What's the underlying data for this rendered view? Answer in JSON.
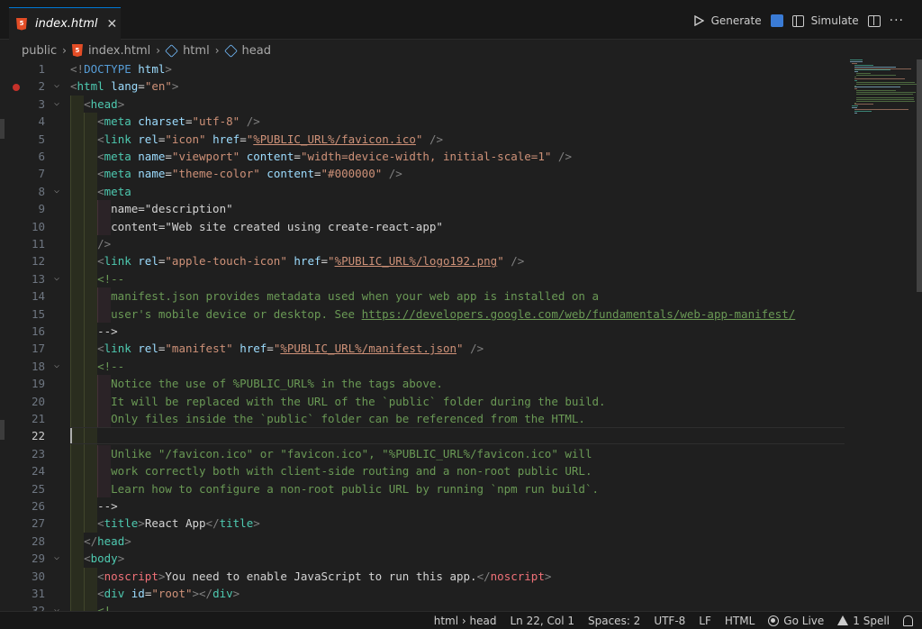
{
  "tab": {
    "title": "index.html",
    "close_glyph": "✕",
    "file_icon": "html5-icon"
  },
  "toolbar": {
    "generate_label": "Generate",
    "simulate_label": "Simulate",
    "more": "···"
  },
  "breadcrumb": {
    "items": [
      "public",
      "index.html",
      "html",
      "head"
    ]
  },
  "editor": {
    "active_line": 22,
    "lines": [
      {
        "n": 1,
        "fold": false,
        "text": "<!DOCTYPE html>"
      },
      {
        "n": 2,
        "fold": true,
        "text": "<html lang=\"en\">"
      },
      {
        "n": 3,
        "fold": true,
        "text": "  <head>"
      },
      {
        "n": 4,
        "fold": false,
        "text": "    <meta charset=\"utf-8\" />"
      },
      {
        "n": 5,
        "fold": false,
        "text": "    <link rel=\"icon\" href=\"%PUBLIC_URL%/favicon.ico\" />"
      },
      {
        "n": 6,
        "fold": false,
        "text": "    <meta name=\"viewport\" content=\"width=device-width, initial-scale=1\" />"
      },
      {
        "n": 7,
        "fold": false,
        "text": "    <meta name=\"theme-color\" content=\"#000000\" />"
      },
      {
        "n": 8,
        "fold": true,
        "text": "    <meta"
      },
      {
        "n": 9,
        "fold": false,
        "text": "      name=\"description\""
      },
      {
        "n": 10,
        "fold": false,
        "text": "      content=\"Web site created using create-react-app\""
      },
      {
        "n": 11,
        "fold": false,
        "text": "    />"
      },
      {
        "n": 12,
        "fold": false,
        "text": "    <link rel=\"apple-touch-icon\" href=\"%PUBLIC_URL%/logo192.png\" />"
      },
      {
        "n": 13,
        "fold": true,
        "text": "    <!--"
      },
      {
        "n": 14,
        "fold": false,
        "text": "      manifest.json provides metadata used when your web app is installed on a"
      },
      {
        "n": 15,
        "fold": false,
        "text": "      user's mobile device or desktop. See https://developers.google.com/web/fundamentals/web-app-manifest/"
      },
      {
        "n": 16,
        "fold": false,
        "text": "    -->"
      },
      {
        "n": 17,
        "fold": false,
        "text": "    <link rel=\"manifest\" href=\"%PUBLIC_URL%/manifest.json\" />"
      },
      {
        "n": 18,
        "fold": true,
        "text": "    <!--"
      },
      {
        "n": 19,
        "fold": false,
        "text": "      Notice the use of %PUBLIC_URL% in the tags above."
      },
      {
        "n": 20,
        "fold": false,
        "text": "      It will be replaced with the URL of the `public` folder during the build."
      },
      {
        "n": 21,
        "fold": false,
        "text": "      Only files inside the `public` folder can be referenced from the HTML."
      },
      {
        "n": 22,
        "fold": false,
        "text": ""
      },
      {
        "n": 23,
        "fold": false,
        "text": "      Unlike \"/favicon.ico\" or \"favicon.ico\", \"%PUBLIC_URL%/favicon.ico\" will"
      },
      {
        "n": 24,
        "fold": false,
        "text": "      work correctly both with client-side routing and a non-root public URL."
      },
      {
        "n": 25,
        "fold": false,
        "text": "      Learn how to configure a non-root public URL by running `npm run build`."
      },
      {
        "n": 26,
        "fold": false,
        "text": "    -->"
      },
      {
        "n": 27,
        "fold": false,
        "text": "    <title>React App</title>"
      },
      {
        "n": 28,
        "fold": false,
        "text": "  </head>"
      },
      {
        "n": 29,
        "fold": true,
        "text": "  <body>"
      },
      {
        "n": 30,
        "fold": false,
        "text": "    <noscript>You need to enable JavaScript to run this app.</noscript>"
      },
      {
        "n": 31,
        "fold": false,
        "text": "    <div id=\"root\"></div>"
      },
      {
        "n": 32,
        "fold": true,
        "text": "    <!--"
      }
    ]
  },
  "statusbar": {
    "breadcrumb": "html › head",
    "position": "Ln 22, Col 1",
    "spaces": "Spaces: 2",
    "encoding": "UTF-8",
    "eol": "LF",
    "language": "HTML",
    "golive": "Go Live",
    "spell": "1 Spell"
  },
  "colors": {
    "accent": "#0078d4",
    "breakpoint": "#c5312a",
    "tag": "#4ec9b0",
    "attr": "#9cdcfe",
    "string": "#ce9178",
    "comment": "#6a9955"
  }
}
